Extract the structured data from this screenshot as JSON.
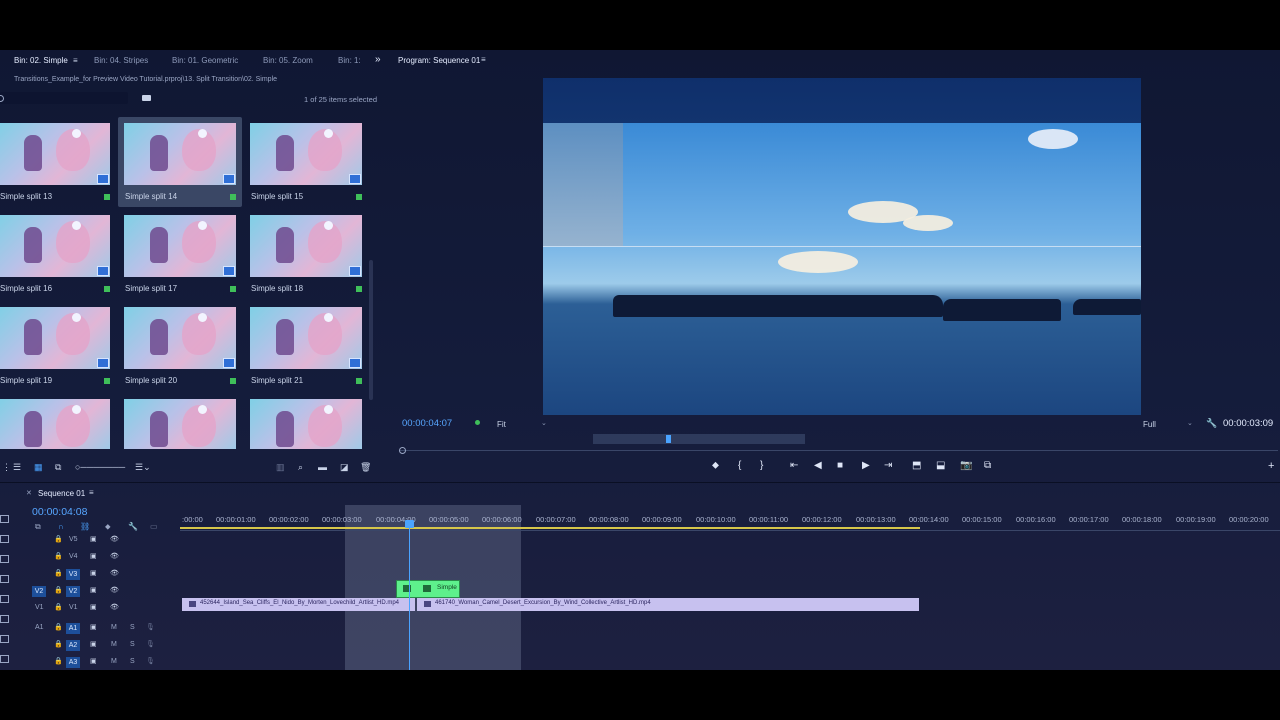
{
  "project": {
    "tabs": [
      "Bin: 02. Simple",
      "Bin: 04. Stripes",
      "Bin: 01. Geometric",
      "Bin: 05. Zoom",
      "Bin: 1:"
    ],
    "path": "Transitions_Example_for Preview Video Tutorial.prproj\\13. Split Transition\\02. Simple",
    "selection_count": "1 of 25 items selected",
    "items": [
      "Simple split 13",
      "Simple split 14",
      "Simple split 15",
      "Simple split 16",
      "Simple split 17",
      "Simple split 18",
      "Simple split 19",
      "Simple split 20",
      "Simple split 21"
    ],
    "selected_item": "Simple split 14"
  },
  "program": {
    "title": "Program: Sequence 01",
    "timecode_left": "00:00:04:07",
    "fit_label": "Fit",
    "quality_label": "Full",
    "timecode_right": "00:00:03:09"
  },
  "timeline": {
    "sequence_tab": "Sequence 01",
    "timecode": "00:00:04:08",
    "ruler": [
      ":00:00",
      "00:00:01:00",
      "00:00:02:00",
      "00:00:03:00",
      "00:00:04:00",
      "00:00:05:00",
      "00:00:06:00",
      "00:00:07:00",
      "00:00:08:00",
      "00:00:09:00",
      "00:00:10:00",
      "00:00:11:00",
      "00:00:12:00",
      "00:00:13:00",
      "00:00:14:00",
      "00:00:15:00",
      "00:00:16:00",
      "00:00:17:00",
      "00:00:18:00",
      "00:00:19:00",
      "00:00:20:00"
    ],
    "video_tracks": [
      "V5",
      "V4",
      "V3",
      "V2",
      "V1"
    ],
    "audio_tracks": [
      "A1",
      "A2",
      "A3"
    ],
    "transition_label": "Simple",
    "clip1": "452644_Island_Sea_Cliffs_El_Nido_By_Morten_Lovechild_Artlist_HD.mp4",
    "clip2": "461740_Woman_Camel_Desert_Excursion_By_Wind_Collective_Artlist_HD.mp4",
    "mute_label": "M",
    "solo_label": "S"
  },
  "colors": {
    "accent_blue": "#4aa3ff",
    "transition_green": "#5ef08c",
    "clip_purple": "#c7c1ef",
    "label_green": "#3fbf5a"
  }
}
